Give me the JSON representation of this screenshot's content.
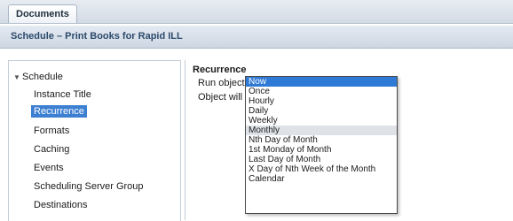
{
  "tabs": [
    {
      "label": "Documents"
    }
  ],
  "header": {
    "title": "Schedule – Print Books for Rapid ILL"
  },
  "sidebar": {
    "root_label": "Schedule",
    "items": [
      {
        "label": "Instance Title"
      },
      {
        "label": "Recurrence",
        "selected": true
      },
      {
        "label": "Formats"
      },
      {
        "label": "Caching"
      },
      {
        "label": "Events"
      },
      {
        "label": "Scheduling Server Group"
      },
      {
        "label": "Destinations"
      }
    ]
  },
  "main": {
    "section_title": "Recurrence",
    "run_object_label": "Run object:",
    "object_will_label": "Object will r",
    "run_object_selected": "Now",
    "run_object_options": [
      "Now",
      "Once",
      "Hourly",
      "Daily",
      "Weekly",
      "Monthly",
      "Nth Day of Month",
      "1st Monday of Month",
      "Last Day of Month",
      "X Day of Nth Week of the Month",
      "Calendar"
    ],
    "hovered_option": "Monthly"
  },
  "colors": {
    "selection": "#2f7ad6",
    "hover": "#dfe3e8"
  }
}
